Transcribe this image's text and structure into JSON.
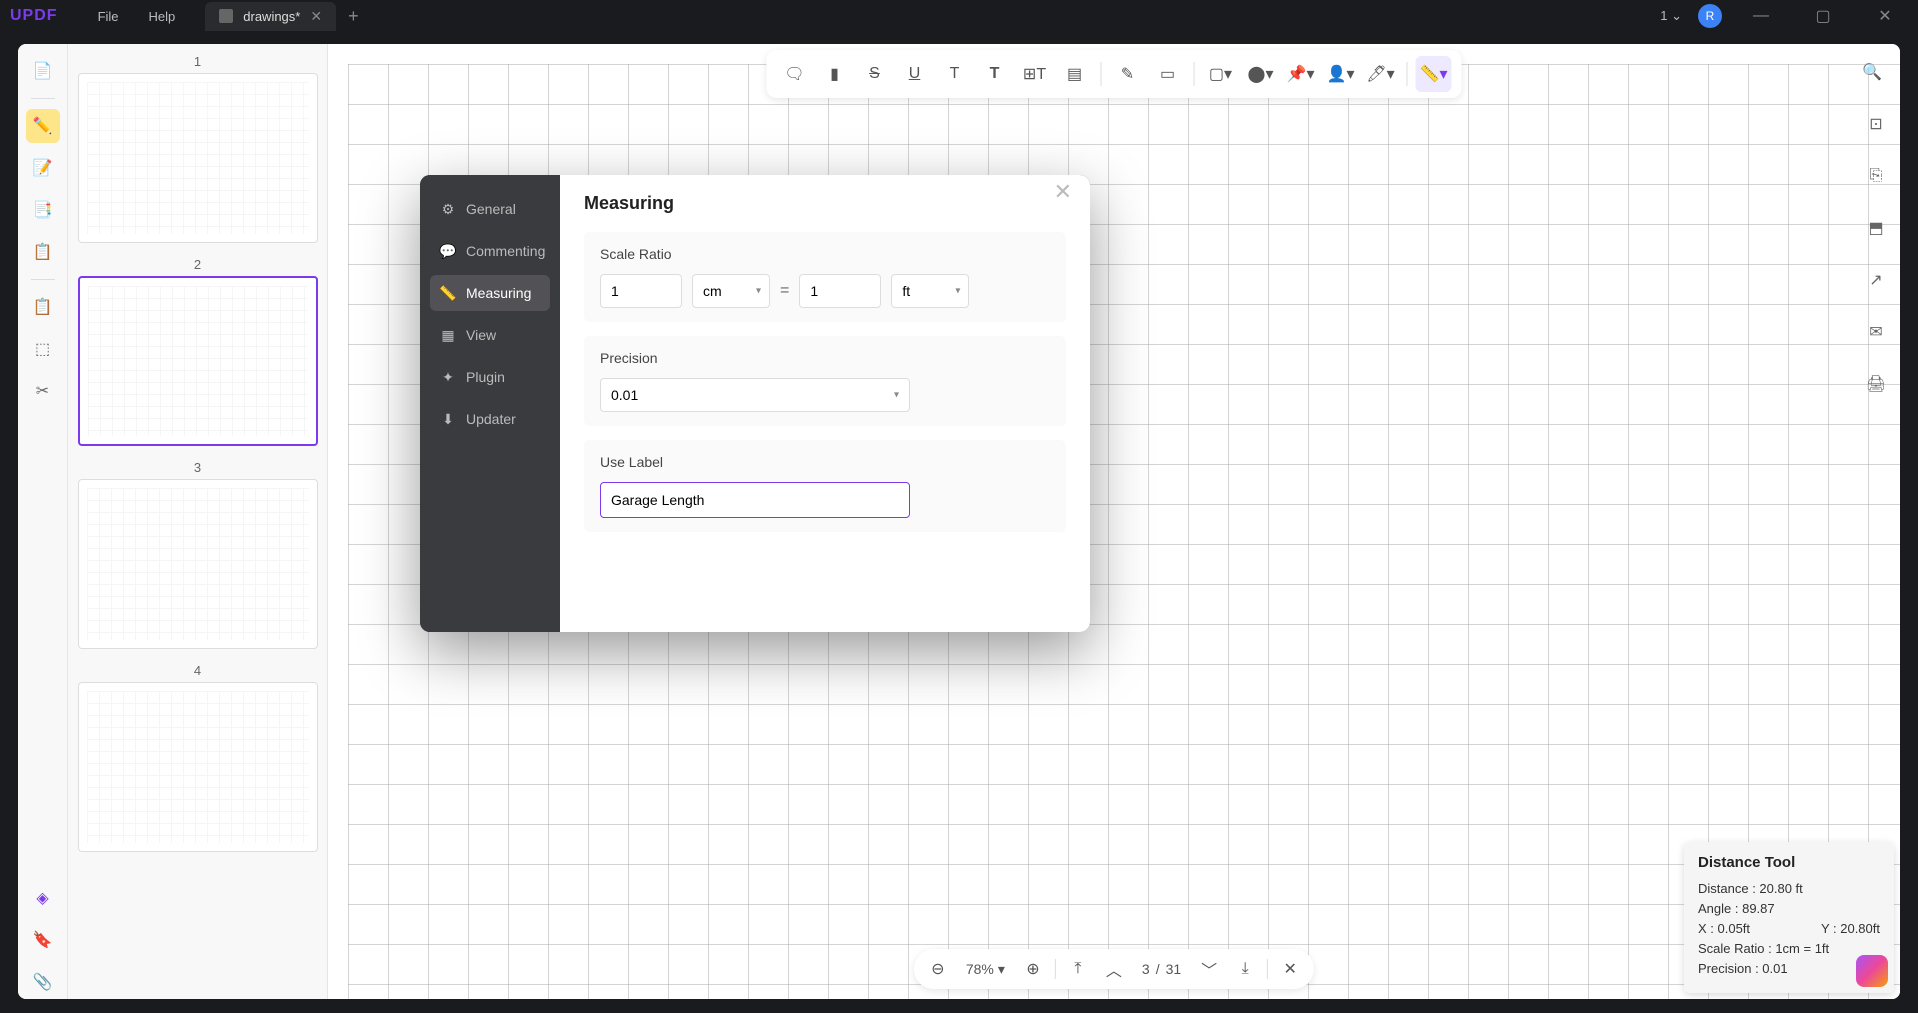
{
  "app": {
    "logo": "UPDF"
  },
  "menu": {
    "file": "File",
    "help": "Help"
  },
  "tab": {
    "name": "drawings*"
  },
  "titlebar": {
    "count": "1",
    "avatar_initial": "R"
  },
  "thumbnails": [
    {
      "num": "1"
    },
    {
      "num": "2"
    },
    {
      "num": "3"
    },
    {
      "num": "4"
    }
  ],
  "modal": {
    "title": "Measuring",
    "tabs": {
      "general": "General",
      "commenting": "Commenting",
      "measuring": "Measuring",
      "view": "View",
      "plugin": "Plugin",
      "updater": "Updater"
    },
    "scale": {
      "label": "Scale Ratio",
      "value1": "1",
      "unit1": "cm",
      "eq": "=",
      "value2": "1",
      "unit2": "ft"
    },
    "precision": {
      "label": "Precision",
      "value": "0.01"
    },
    "use_label": {
      "label": "Use Label",
      "value": "Garage Length"
    }
  },
  "distance_tool": {
    "title": "Distance Tool",
    "distance": "Distance : 20.80 ft",
    "angle": "Angle : 89.87",
    "x": "X : 0.05ft",
    "y": "Y : 20.80ft",
    "scale_ratio": "Scale Ratio : 1cm = 1ft",
    "precision": "Precision : 0.01"
  },
  "bottom": {
    "zoom": "78%",
    "page_current": "3",
    "page_sep": "/",
    "page_total": "31"
  }
}
